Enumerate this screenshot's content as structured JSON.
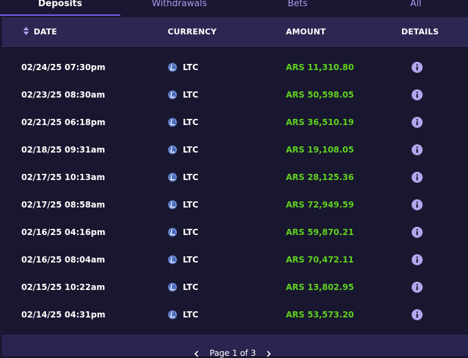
{
  "tabs": [
    {
      "label": "Deposits",
      "active": true
    },
    {
      "label": "Withdrawals",
      "active": false
    },
    {
      "label": "Bets",
      "active": false
    },
    {
      "label": "All",
      "active": false
    }
  ],
  "table": {
    "headers": {
      "date": "DATE",
      "currency": "CURRENCY",
      "amount": "AMOUNT",
      "details": "DETAILS"
    },
    "rows": [
      {
        "date": "02/24/25 07:30pm",
        "currency": "LTC",
        "amount": "ARS 11,310.80"
      },
      {
        "date": "02/23/25 08:30am",
        "currency": "LTC",
        "amount": "ARS 50,598.05"
      },
      {
        "date": "02/21/25 06:18pm",
        "currency": "LTC",
        "amount": "ARS 36,510.19"
      },
      {
        "date": "02/18/25 09:31am",
        "currency": "LTC",
        "amount": "ARS 19,108.05"
      },
      {
        "date": "02/17/25 10:13am",
        "currency": "LTC",
        "amount": "ARS 28,125.36"
      },
      {
        "date": "02/17/25 08:58am",
        "currency": "LTC",
        "amount": "ARS 72,949.59"
      },
      {
        "date": "02/16/25 04:16pm",
        "currency": "LTC",
        "amount": "ARS 59,870.21"
      },
      {
        "date": "02/16/25 08:04am",
        "currency": "LTC",
        "amount": "ARS 70,472.11"
      },
      {
        "date": "02/15/25 10:22am",
        "currency": "LTC",
        "amount": "ARS 13,802.95"
      },
      {
        "date": "02/14/25 04:31pm",
        "currency": "LTC",
        "amount": "ARS 53,573.20"
      }
    ]
  },
  "pagination": {
    "label": "Page 1 of 3"
  },
  "icons": {
    "sort": "sort-icon",
    "currency": "litecoin-icon",
    "details": "info-icon",
    "prev": "chevron-left-icon",
    "next": "chevron-right-icon"
  },
  "colors": {
    "background": "#1a1732",
    "header": "#2c2752",
    "amount": "#5fd21f",
    "accent": "#7b5cf0",
    "tab_inactive": "#a99ef0",
    "info": "#b3a6ee",
    "ltc": "#4a6bbf"
  }
}
